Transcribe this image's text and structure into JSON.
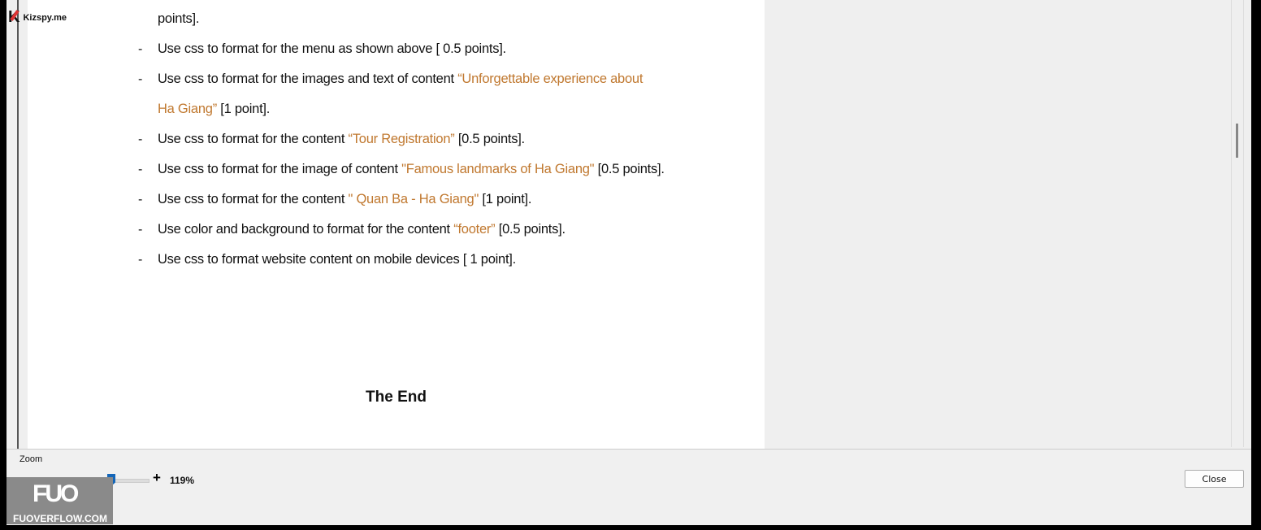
{
  "watermark_top": "Kizspy.me",
  "watermark_bottom": {
    "logo": "FUO",
    "text": "FUOVERFLOW.COM"
  },
  "document": {
    "lines": [
      {
        "parts": [
          "points]."
        ],
        "dash": false
      },
      {
        "parts": [
          "Use css to format for the menu as shown above [ 0.5 points]."
        ],
        "dash": true
      },
      {
        "parts": [
          "Use css to format for the images and text of content  ",
          "“Unforgettable experience about"
        ],
        "dash": true
      },
      {
        "parts": [
          "",
          "Ha Giang”",
          "  [1 point]."
        ],
        "dash": false
      },
      {
        "parts": [
          "Use css  to format for the content ",
          "“Tour Registration”",
          " [0.5 points]."
        ],
        "dash": true
      },
      {
        "parts": [
          "Use css to format for the image of content ",
          "\"Famous landmarks of Ha Giang\"",
          " [0.5 points]."
        ],
        "dash": true
      },
      {
        "parts": [
          "Use css to format for the content ",
          "\" Quan Ba - Ha Giang\"",
          " [1 point]."
        ],
        "dash": true
      },
      {
        "parts": [
          "Use color and background  to format for the content ",
          "“footer”",
          " [0.5 points]."
        ],
        "dash": true
      },
      {
        "parts": [
          "Use css to format website content on mobile devices [ 1 point]."
        ],
        "dash": true
      }
    ],
    "dash_char": "-",
    "the_end": "The End",
    "highlight_color": "#c0782f"
  },
  "zoom": {
    "label": "Zoom",
    "minus": "-",
    "plus": "+",
    "percent_text": "119%",
    "value_percent": 119
  },
  "close_label": "Close"
}
